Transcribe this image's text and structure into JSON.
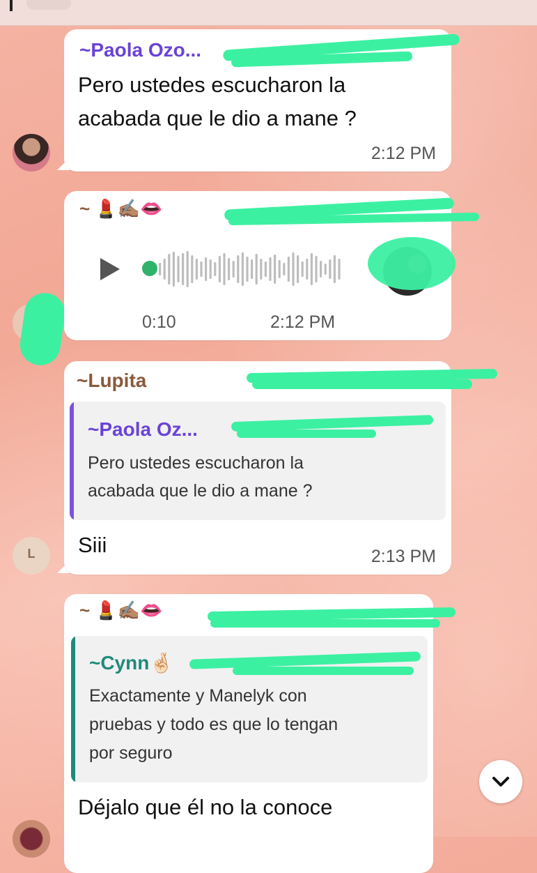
{
  "messages": [
    {
      "sender": "~Paola Ozo...",
      "text_line1": "Pero ustedes escucharon la",
      "text_line2": "acabada que le dio a mane ?",
      "time": "2:12 PM"
    },
    {
      "sender_prefix": "~",
      "sender_emojis": "💄✍🏽👄",
      "voice_duration": "0:10",
      "time": "2:12 PM"
    },
    {
      "sender": "~Lupita",
      "quoted_sender": "~Paola Oz...",
      "quoted_line1": "Pero ustedes escucharon la",
      "quoted_line2": "acabada que le dio a mane ?",
      "text": "Siii",
      "time": "2:13 PM",
      "avatar_letter": "L"
    },
    {
      "sender_prefix": "~",
      "sender_emojis": "💄✍🏽👄",
      "quoted_sender": "~Cynn",
      "quoted_emoji": "🤞🏻",
      "quoted_line1": "Exactamente y Manelyk con",
      "quoted_line2": "pruebas y todo es que lo tengan",
      "quoted_line3": "por seguro",
      "text": "Déjalo que él no la conoce"
    }
  ],
  "colors": {
    "sender_paola": "#6a43d6",
    "sender_lupita": "#8a5a3c",
    "sender_cynn": "#1f8a7a",
    "quote_stripe_purple": "#7b53dc",
    "quote_stripe_teal": "#1f8a7a",
    "redaction": "#3cf0a2"
  },
  "icons": {
    "play": "play-icon",
    "scroll_down": "chevron-down-icon"
  }
}
